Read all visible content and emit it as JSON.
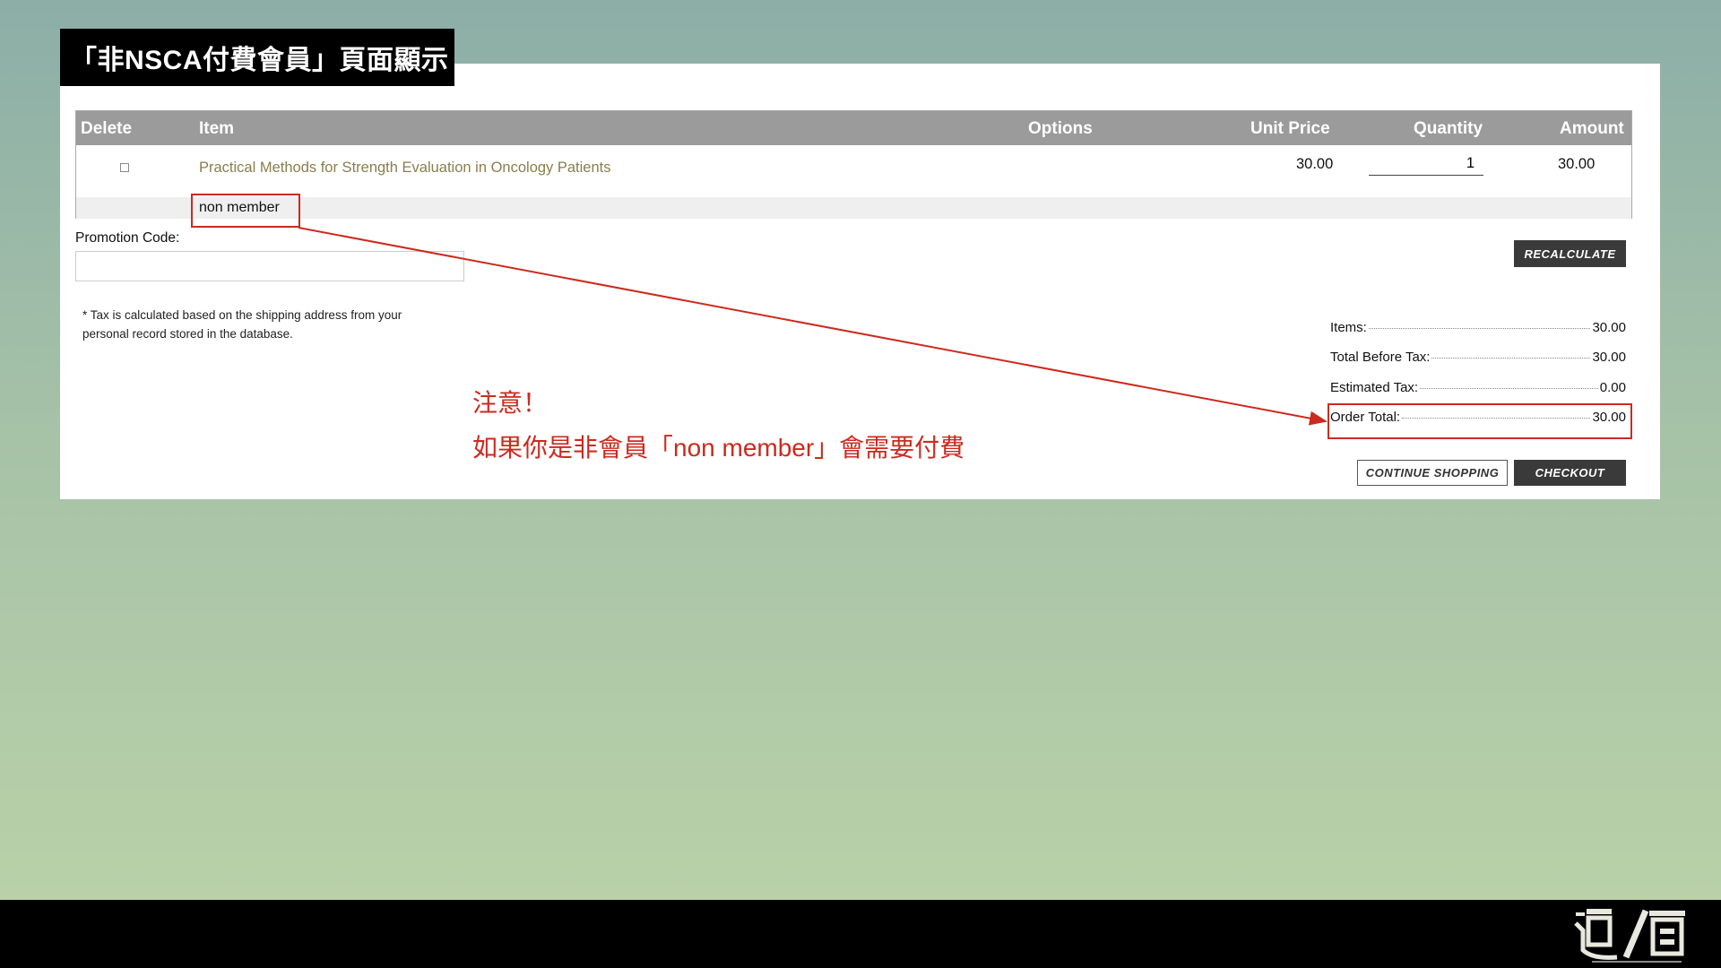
{
  "slide": {
    "title": "「非NSCA付費會員」頁面顯示",
    "notice_line1": "注意！",
    "notice_line2": "如果你是非會員「non member」會需要付費"
  },
  "cart": {
    "headers": {
      "delete": "Delete",
      "item": "Item",
      "options": "Options",
      "unit_price": "Unit Price",
      "quantity": "Quantity",
      "amount": "Amount"
    },
    "rows": [
      {
        "item": "Practical Methods for Strength Evaluation in Oncology Patients",
        "unit_price": "30.00",
        "quantity": "1",
        "amount": "30.00",
        "member_type": "non member"
      }
    ]
  },
  "promo": {
    "label": "Promotion Code:",
    "value": ""
  },
  "tax_note": "* Tax is calculated based on the shipping address from your personal record stored in the database.",
  "buttons": {
    "recalculate": "RECALCULATE",
    "continue_shopping": "CONTINUE SHOPPING",
    "checkout": "CHECKOUT"
  },
  "summary": {
    "items_label": "Items:",
    "items_value": "30.00",
    "before_tax_label": "Total Before Tax:",
    "before_tax_value": "30.00",
    "estimated_tax_label": "Estimated Tax:",
    "estimated_tax_value": "0.00",
    "order_total_label": "Order Total:",
    "order_total_value": "30.00"
  },
  "colors": {
    "annotation_red": "#cc2a1f",
    "link_olive": "#8a7e4b",
    "header_gray": "#9b9b9b"
  }
}
